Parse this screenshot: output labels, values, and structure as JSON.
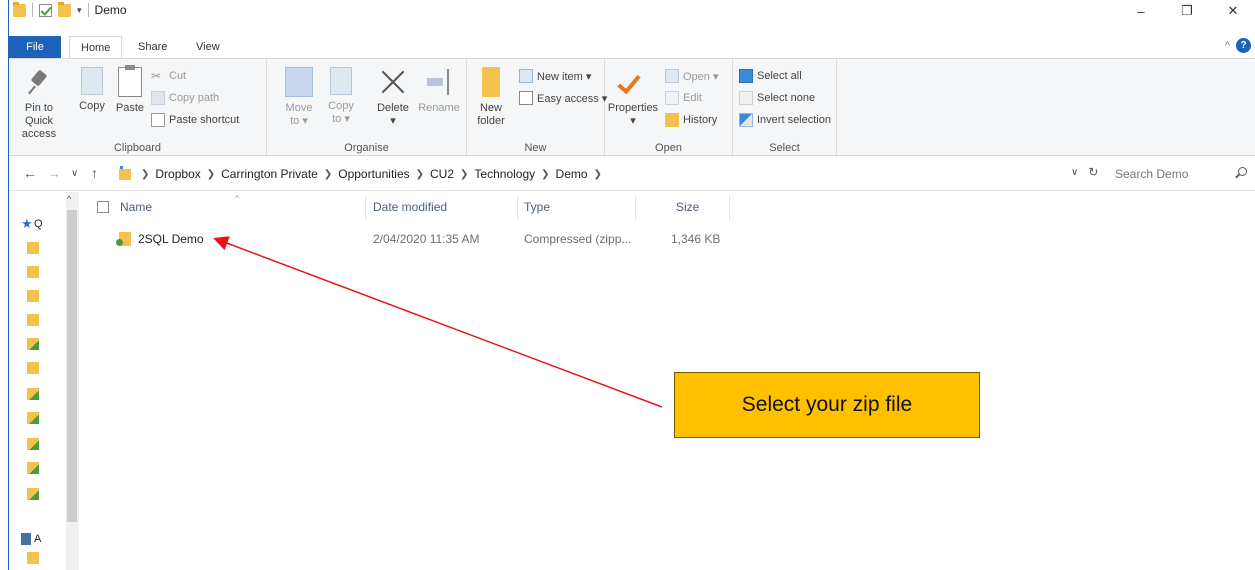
{
  "window": {
    "title": "Demo",
    "controls": {
      "minimize": "–",
      "restore": "❐",
      "close": "✕"
    }
  },
  "ribbon_tabs": [
    "File",
    "Home",
    "Share",
    "View"
  ],
  "ribbon": {
    "clipboard": {
      "label": "Clipboard",
      "pin_to_quick_access": [
        "Pin to Quick",
        "access"
      ],
      "copy": "Copy",
      "paste": "Paste",
      "cut": "Cut",
      "copy_path": "Copy path",
      "paste_shortcut": "Paste shortcut"
    },
    "organise": {
      "label": "Organise",
      "move_to": [
        "Move",
        "to ▾"
      ],
      "copy_to": [
        "Copy",
        "to ▾"
      ],
      "delete": [
        "Delete",
        "▾"
      ],
      "rename": "Rename"
    },
    "new": {
      "label": "New",
      "new_folder": [
        "New",
        "folder"
      ],
      "new_item": "New item ▾",
      "easy_access": "Easy access ▾"
    },
    "open": {
      "label": "Open",
      "properties": [
        "Properties",
        "▾"
      ],
      "open": "Open ▾",
      "edit": "Edit",
      "history": "History"
    },
    "select": {
      "label": "Select",
      "select_all": "Select all",
      "select_none": "Select none",
      "invert_selection": "Invert selection"
    }
  },
  "address": {
    "breadcrumbs": [
      "Dropbox",
      "Carrington Private",
      "Opportunities",
      "CU2",
      "Technology",
      "Demo"
    ],
    "search_placeholder": "Search Demo"
  },
  "nav_pane": {
    "quick_access_letter": "Q",
    "other_letter": "A"
  },
  "columns": [
    "Name",
    "Date modified",
    "Type",
    "Size"
  ],
  "files": [
    {
      "name": "2SQL Demo",
      "date_modified": "2/04/2020 11:35 AM",
      "type": "Compressed (zipp...",
      "size": "1,346 KB"
    }
  ],
  "annotation": {
    "callout_text": "Select your zip file",
    "arrow_color": "#e8141b",
    "callout_color": "#ffc000"
  }
}
